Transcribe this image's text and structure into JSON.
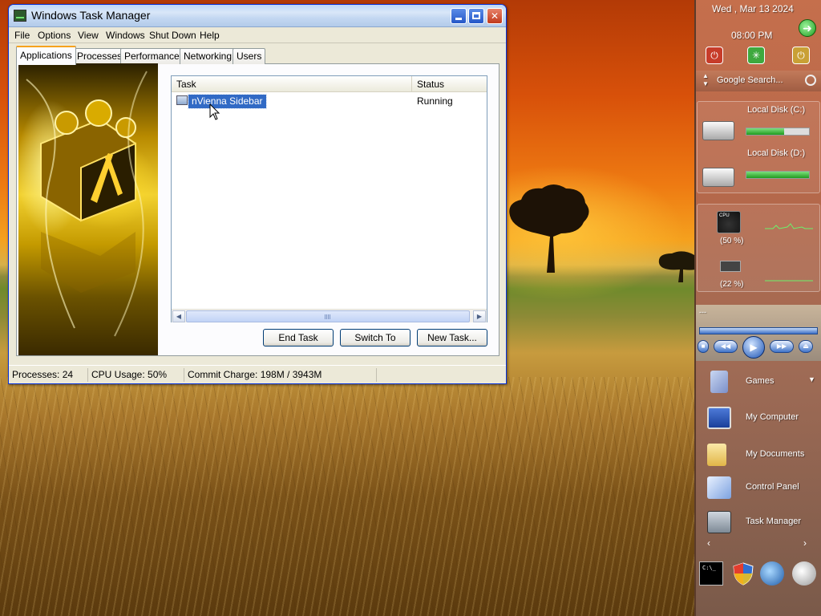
{
  "window": {
    "title": "Windows Task Manager",
    "minimize_icon": "minimize-icon",
    "maximize_icon": "maximize-icon",
    "close_icon": "close-icon"
  },
  "menu": {
    "items": [
      "File",
      "Options",
      "View",
      "Windows",
      "Shut Down",
      "Help"
    ]
  },
  "tabs": {
    "items": [
      "Applications",
      "Processes",
      "Performance",
      "Networking",
      "Users"
    ],
    "active": "Applications"
  },
  "task_list": {
    "columns": [
      "Task",
      "Status"
    ],
    "rows": [
      {
        "task": "nVienna Sidebar",
        "status": "Running"
      }
    ]
  },
  "buttons": {
    "end_task": "End Task",
    "switch_to": "Switch To",
    "new_task": "New Task..."
  },
  "status_bar": {
    "processes": "Processes: 24",
    "cpu": "CPU Usage: 50%",
    "commit": "Commit Charge: 198M / 3943M"
  },
  "sidebar": {
    "date": "Wed , Mar 13 2024",
    "time": "08:00 PM",
    "search_placeholder": "Google Search...",
    "disks": [
      {
        "label": "Local Disk (C:)",
        "usage": 0.6
      },
      {
        "label": "Local Disk (D:)",
        "usage": 1.0
      }
    ],
    "cpu_label": "(50 %)",
    "ram_label": "(22 %)",
    "cpu_gauge_text": "CPU",
    "media_status": "---",
    "items": [
      "Games",
      "My Computer",
      "My Documents",
      "Control Panel",
      "Task Manager"
    ]
  },
  "colors": {
    "selection": "#316ac5",
    "xp_blue": "#0831d9",
    "tab_highlight": "#f6a21d"
  }
}
